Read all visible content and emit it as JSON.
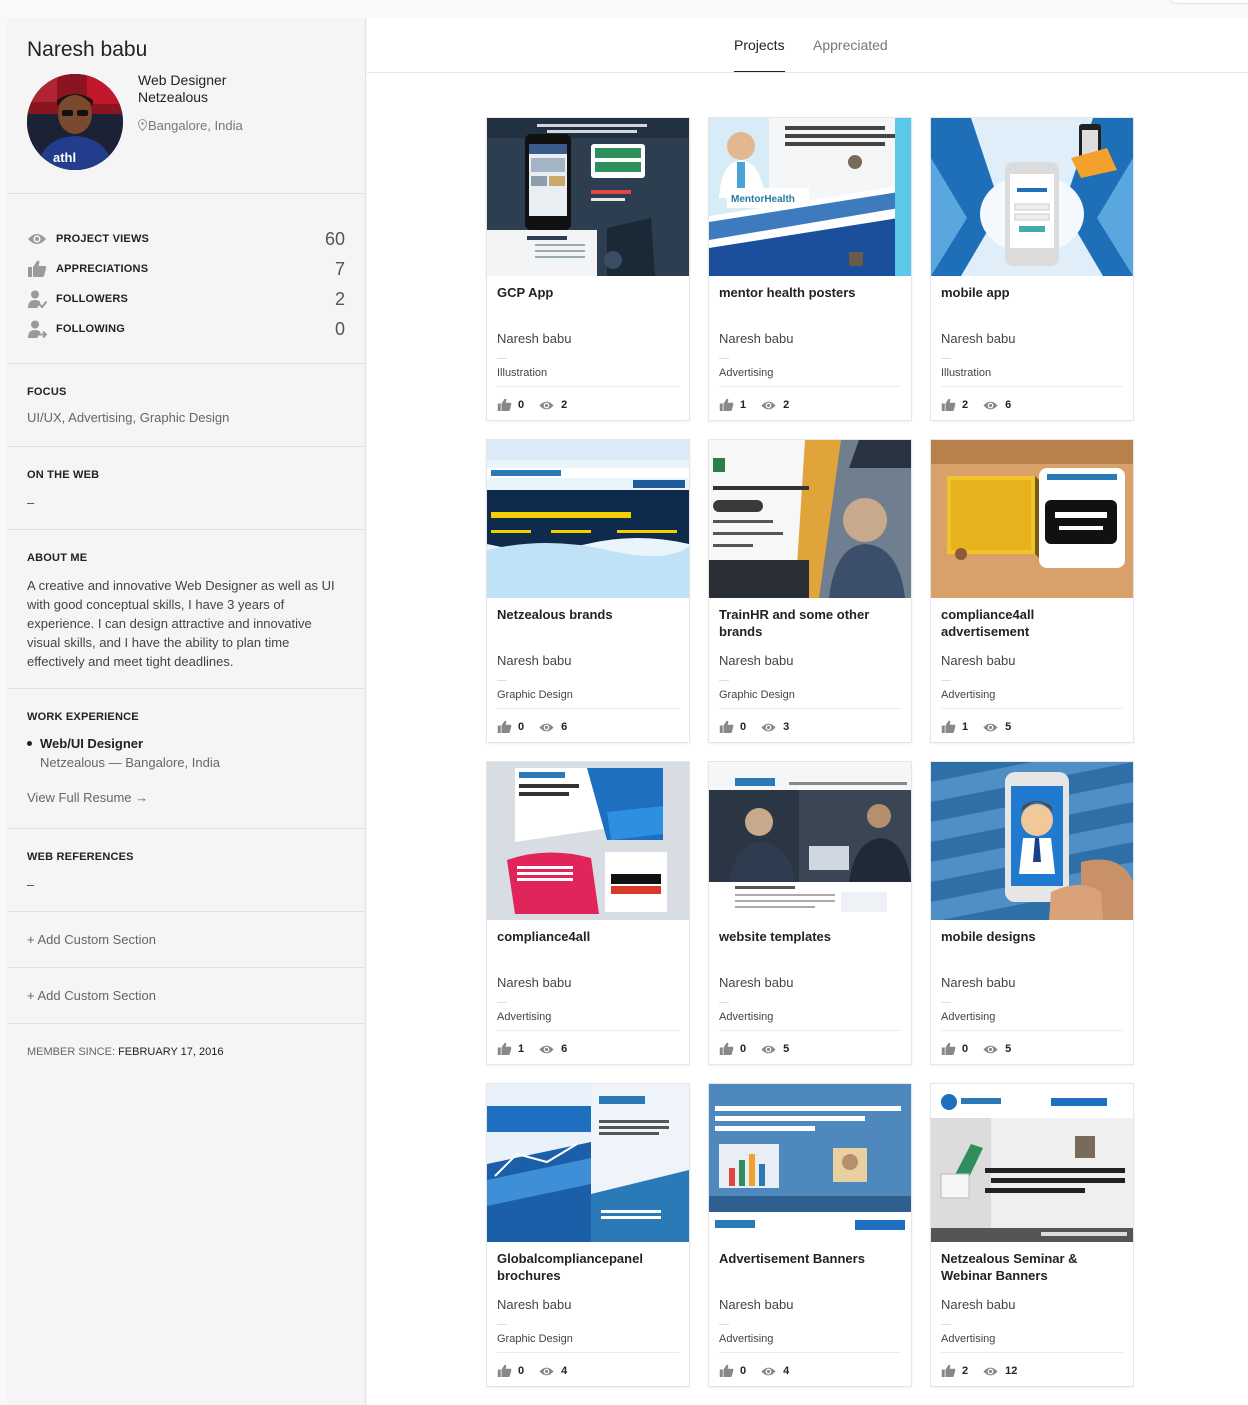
{
  "profile": {
    "name": "Naresh babu",
    "occupation": "Web Designer",
    "company": "Netzealous",
    "location": "Bangalore, India"
  },
  "stats": [
    {
      "label": "PROJECT VIEWS",
      "value": "60",
      "icon": "eye-icon"
    },
    {
      "label": "APPRECIATIONS",
      "value": "7",
      "icon": "thumbs-up-icon"
    },
    {
      "label": "FOLLOWERS",
      "value": "2",
      "icon": "followers-icon"
    },
    {
      "label": "FOLLOWING",
      "value": "0",
      "icon": "following-icon"
    }
  ],
  "focus": {
    "heading": "FOCUS",
    "text": "UI/UX, Advertising, Graphic Design"
  },
  "on_the_web": {
    "heading": "ON THE WEB",
    "text": "–"
  },
  "about": {
    "heading": "ABOUT ME",
    "text": "A creative and innovative Web Designer as well as UI with good conceptual skills, I have 3 years of experience. I can design attractive and innovative visual skills, and I have the ability to plan time effectively and meet tight deadlines."
  },
  "work": {
    "heading": "WORK EXPERIENCE",
    "job_title": "Web/UI Designer",
    "job_detail": "Netzealous — Bangalore, India",
    "resume_link": "View Full Resume →"
  },
  "web_references": {
    "heading": "WEB REFERENCES",
    "text": "–"
  },
  "custom_sections": [
    "+ Add Custom Section",
    "+ Add Custom Section"
  ],
  "member_since": {
    "label": "MEMBER SINCE:",
    "date": "FEBRUARY 17, 2016"
  },
  "tabs": [
    {
      "label": "Projects",
      "active": true
    },
    {
      "label": "Appreciated",
      "active": false
    }
  ],
  "projects": [
    {
      "title": "GCP App",
      "owner": "Naresh babu",
      "field": "Illustration",
      "appreciations": "0",
      "views": "2",
      "thumb": "gcp-app"
    },
    {
      "title": "mentor health posters",
      "owner": "Naresh babu",
      "field": "Advertising",
      "appreciations": "1",
      "views": "2",
      "thumb": "mentor-health"
    },
    {
      "title": "mobile app",
      "owner": "Naresh babu",
      "field": "Illustration",
      "appreciations": "2",
      "views": "6",
      "thumb": "mobile-app"
    },
    {
      "title": "Netzealous brands",
      "owner": "Naresh babu",
      "field": "Graphic Design",
      "appreciations": "0",
      "views": "6",
      "thumb": "netzealous-brands"
    },
    {
      "title": "TrainHR and some other brands",
      "owner": "Naresh babu",
      "field": "Graphic Design",
      "appreciations": "0",
      "views": "3",
      "thumb": "trainhr"
    },
    {
      "title": "compliance4all advertisement",
      "owner": "Naresh babu",
      "field": "Advertising",
      "appreciations": "1",
      "views": "5",
      "thumb": "compliance-ad"
    },
    {
      "title": "compliance4all",
      "owner": "Naresh babu",
      "field": "Advertising",
      "appreciations": "1",
      "views": "6",
      "thumb": "compliance4all"
    },
    {
      "title": "website templates",
      "owner": "Naresh babu",
      "field": "Advertising",
      "appreciations": "0",
      "views": "5",
      "thumb": "website-templates"
    },
    {
      "title": "mobile designs",
      "owner": "Naresh babu",
      "field": "Advertising",
      "appreciations": "0",
      "views": "5",
      "thumb": "mobile-designs"
    },
    {
      "title": "Globalcompliancepanel brochures",
      "owner": "Naresh babu",
      "field": "Graphic Design",
      "appreciations": "0",
      "views": "4",
      "thumb": "gcp-brochures"
    },
    {
      "title": "Advertisement Banners",
      "owner": "Naresh babu",
      "field": "Advertising",
      "appreciations": "0",
      "views": "4",
      "thumb": "ad-banners"
    },
    {
      "title": "Netzealous Seminar & Webinar Banners",
      "owner": "Naresh babu",
      "field": "Advertising",
      "appreciations": "2",
      "views": "12",
      "thumb": "seminar-banners"
    }
  ]
}
